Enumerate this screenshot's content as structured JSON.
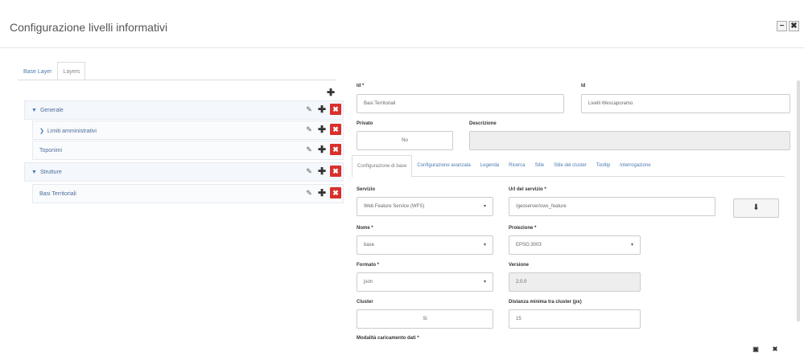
{
  "window": {
    "title": "Configurazione livelli informativi",
    "minimize_glyph": "−",
    "close_glyph": "✖"
  },
  "tabs": [
    {
      "label": "Base Layer",
      "active": false
    },
    {
      "label": "Layers",
      "active": true
    }
  ],
  "tree": {
    "add_glyph": "✚",
    "items": [
      {
        "label": "Generale",
        "caret": "▼",
        "level": 0
      },
      {
        "label": "Limiti amministrativi",
        "caret": "❯",
        "level": 1
      },
      {
        "label": "Toponimi",
        "caret": "",
        "level": 1
      },
      {
        "label": "Strutture",
        "caret": "▼",
        "level": 0
      },
      {
        "label": "Basi Territoriali",
        "caret": "",
        "level": 1
      }
    ],
    "action_icons": {
      "edit": "✎",
      "add": "✚",
      "delete": "✖"
    }
  },
  "form": {
    "id_label": "Id *",
    "id_value": "Basi Territoriali",
    "name_label": "Id",
    "name_value": "Livelli Wescaporamo",
    "preview_label": "Privato",
    "preview_value": "No",
    "description_label": "Descrizione",
    "description_value": "",
    "inner_tabs": [
      {
        "label": "Configurazione di base",
        "active": true
      },
      {
        "label": "Configurazione avanzata",
        "active": false
      },
      {
        "label": "Legenda",
        "active": false
      },
      {
        "label": "Ricerca",
        "active": false
      },
      {
        "label": "Stile",
        "active": false
      },
      {
        "label": "Stile del cluster",
        "active": false
      },
      {
        "label": "Tooltip",
        "active": false
      },
      {
        "label": "Interrogazione",
        "active": false
      }
    ],
    "service_label": "Servizio",
    "service_value": "Web Feature Service (WFS)",
    "url_label": "Url del servizio *",
    "url_value": "/geoserver/ows_feature",
    "download_glyph": "⬇",
    "nome_label": "Nome *",
    "nome_value": "base",
    "proiezione_label": "Proiezione *",
    "proiezione_value": "EPSG:3003",
    "formato_label": "Formato *",
    "formato_value": "json",
    "versione_label": "Versione",
    "versione_value": "2.0.0",
    "cluster_label": "Cluster",
    "cluster_value": "Si",
    "distanza_label": "Distanza minima tra cluster (px)",
    "distanza_value": "15",
    "modalita_label": "Modalità caricamento dati *",
    "select_caret": "▾"
  },
  "footer": {
    "save_glyph": "▣",
    "close_glyph": "✖"
  }
}
